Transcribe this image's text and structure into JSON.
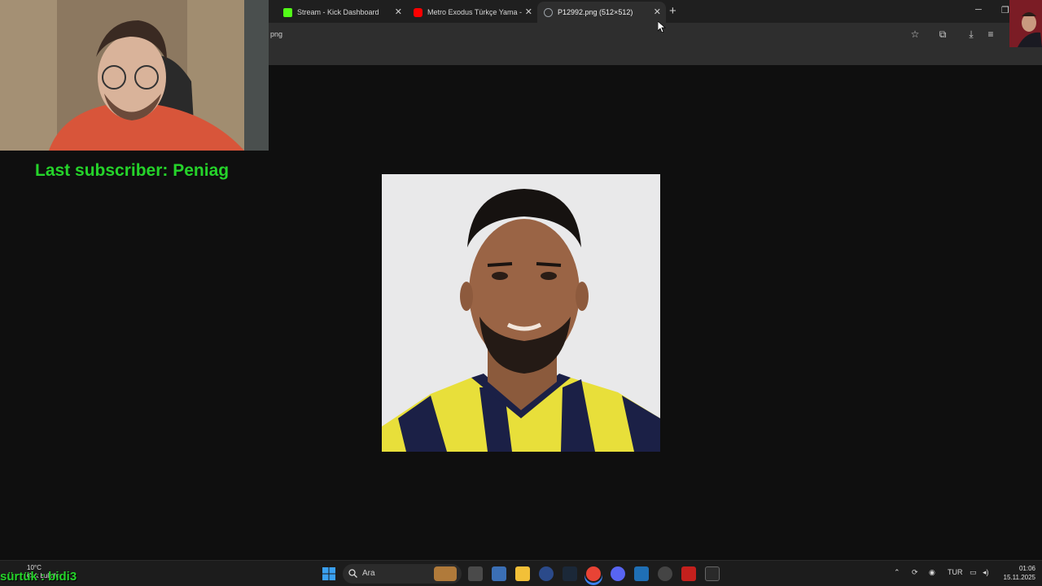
{
  "browser": {
    "tabs": [
      {
        "title": "Stream - Kick Dashboard",
        "favicon": "kick-logo-icon",
        "color": "#53fc18"
      },
      {
        "title": "Metro Exodus Türkçe Yama - Yo",
        "favicon": "youtube-icon",
        "color": "#ff0000"
      },
      {
        "title": "P12992.png (512×512)",
        "favicon": "globe-icon",
        "color": "#9aa0a6",
        "active": true
      }
    ],
    "url_fragment": "png",
    "new_tab_label": "+"
  },
  "overlay": {
    "last_subscriber_label": "Last subscriber: Peniag",
    "bottom_text": "sürtük : bidi3",
    "accent_color": "#25d32a"
  },
  "taskbar": {
    "search_placeholder": "Ara",
    "weather_temp": "10°C",
    "weather_desc": "Çok bulutlu",
    "language": "TUR",
    "time": "01:06",
    "date": "15.11.2025"
  }
}
